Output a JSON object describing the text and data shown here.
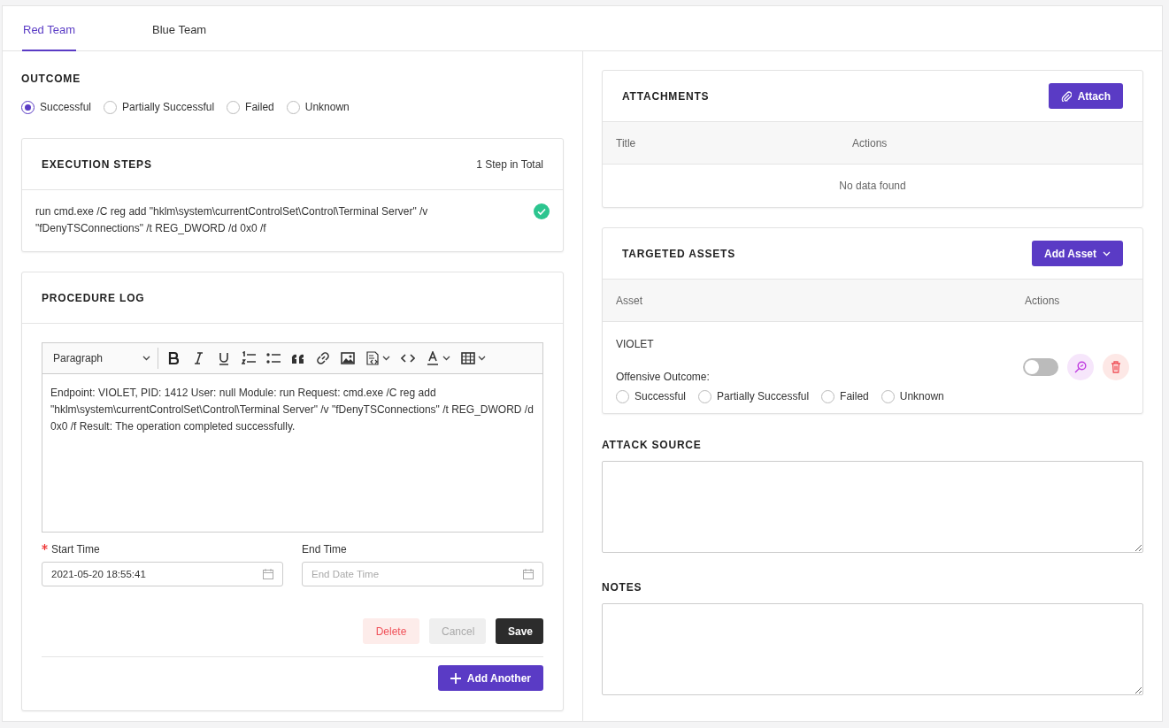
{
  "tabs": [
    {
      "label": "Red Team",
      "selected": true
    },
    {
      "label": "Blue Team",
      "selected": false
    }
  ],
  "outcome": {
    "title": "OUTCOME",
    "options": [
      {
        "label": "Successful",
        "selected": true
      },
      {
        "label": "Partially Successful",
        "selected": false
      },
      {
        "label": "Failed",
        "selected": false
      },
      {
        "label": "Unknown",
        "selected": false
      }
    ]
  },
  "execution_steps": {
    "title": "EXECUTION STEPS",
    "count": "1 Step in Total",
    "steps": [
      {
        "text": "run cmd.exe /C reg add \"hklm\\system\\currentControlSet\\Control\\Terminal Server\" /v \"fDenyTSConnections\" /t REG_DWORD /d 0x0 /f",
        "done": true
      }
    ]
  },
  "procedure_log": {
    "title": "PROCEDURE LOG",
    "editor": {
      "block_style": "Paragraph",
      "content": "Endpoint: VIOLET, PID: 1412 User: null Module: run Request: cmd.exe /C reg add \"hklm\\system\\currentControlSet\\Control\\Terminal Server\" /v \"fDenyTSConnections\" /t REG_DWORD /d 0x0 /f Result: The operation completed successfully."
    },
    "start_time": {
      "label": "Start Time",
      "required": true,
      "value": "2021-05-20 18:55:41"
    },
    "end_time": {
      "label": "End Time",
      "required": false,
      "placeholder": "End Date Time"
    },
    "buttons": [
      {
        "label": "Delete",
        "kind": "delete",
        "disabled": false
      },
      {
        "label": "Cancel",
        "kind": "cancel",
        "disabled": true
      },
      {
        "label": "Save",
        "kind": "save",
        "disabled": false
      }
    ],
    "add_button": {
      "label": "Add Another"
    }
  },
  "attachments": {
    "title": "ATTACHMENTS",
    "button": "Attach",
    "columns": [
      "Title",
      "Actions"
    ],
    "empty": "No data found"
  },
  "targeted_assets": {
    "title": "TARGETED ASSETS",
    "button": "Add Asset",
    "columns": [
      "Asset",
      "Actions"
    ],
    "rows": [
      {
        "name": "VIOLET",
        "outcome_label": "Offensive Outcome:",
        "enabled": false,
        "options": [
          {
            "label": "Successful",
            "selected": false
          },
          {
            "label": "Partially Successful",
            "selected": false
          },
          {
            "label": "Failed",
            "selected": false
          },
          {
            "label": "Unknown",
            "selected": false
          }
        ]
      }
    ]
  },
  "attack_source": {
    "label": "ATTACK SOURCE"
  },
  "notes": {
    "label": "NOTES"
  }
}
